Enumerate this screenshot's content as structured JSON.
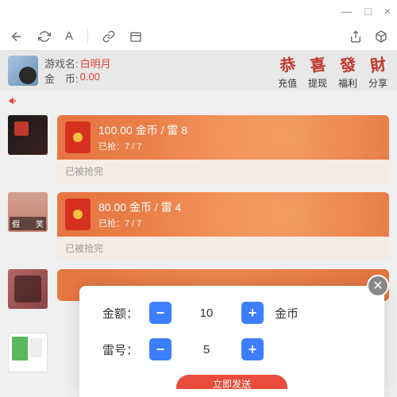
{
  "titlebar": {
    "min": "—",
    "max": "□",
    "close": "×"
  },
  "user": {
    "name_label": "游戏名:",
    "name": "白明月",
    "coin_label": "金　币:",
    "coin": "0.00"
  },
  "actions": [
    {
      "glyph": "恭",
      "label": "充值"
    },
    {
      "glyph": "喜",
      "label": "提现"
    },
    {
      "glyph": "發",
      "label": "福利"
    },
    {
      "glyph": "財",
      "label": "分享"
    }
  ],
  "feed": [
    {
      "line1": "100.00 金币 / 雷 8",
      "line2": "已抢：7 / 7",
      "status": "已被抢完",
      "thumb": "t1",
      "tags": []
    },
    {
      "line1": "80.00 金币 / 雷 4",
      "line2": "已抢：7 / 7",
      "status": "已被抢完",
      "thumb": "t2",
      "tags": [
        "假",
        "笑"
      ]
    }
  ],
  "modal": {
    "amount_label": "金额：",
    "amount_value": "10",
    "unit": "金币",
    "mine_label": "雷号：",
    "mine_value": "5",
    "send": "立即发送"
  }
}
